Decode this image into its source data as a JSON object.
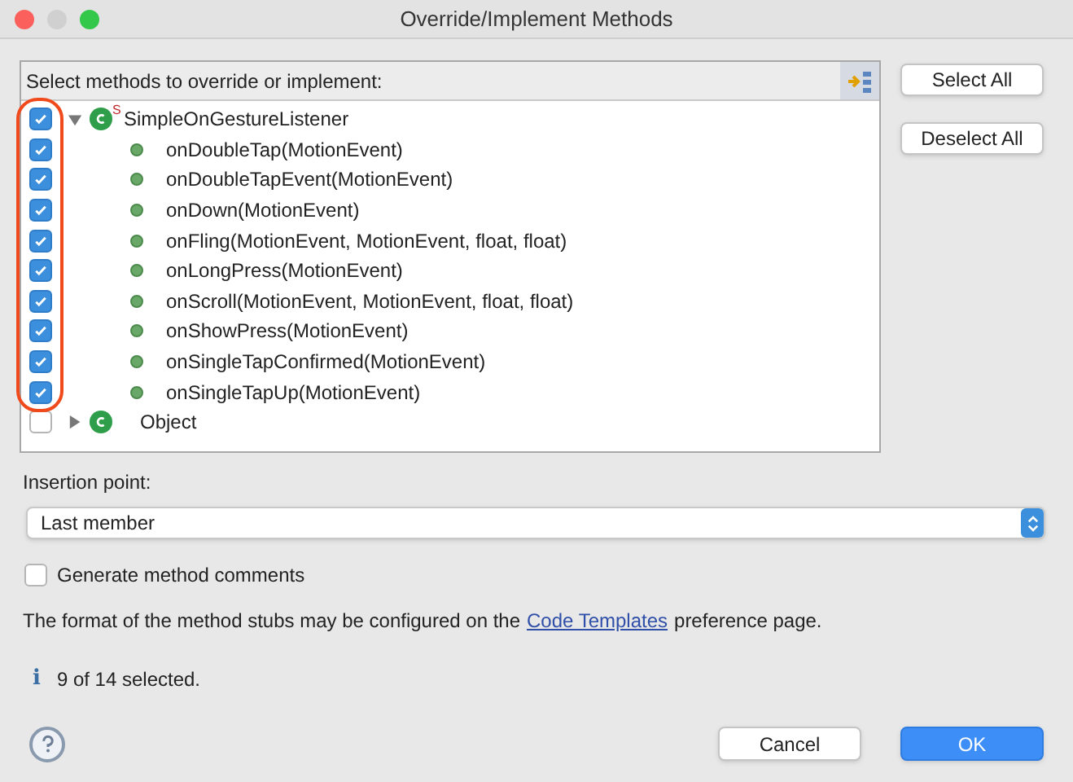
{
  "window": {
    "title": "Override/Implement Methods"
  },
  "methods_panel": {
    "label": "Select methods to override or implement:",
    "tree": [
      {
        "label": "SimpleOnGestureListener",
        "decorator": "S",
        "checked": true,
        "expanded": true,
        "children": [
          {
            "label": "onDoubleTap(MotionEvent)",
            "checked": true
          },
          {
            "label": "onDoubleTapEvent(MotionEvent)",
            "checked": true
          },
          {
            "label": "onDown(MotionEvent)",
            "checked": true
          },
          {
            "label": "onFling(MotionEvent, MotionEvent, float, float)",
            "checked": true
          },
          {
            "label": "onLongPress(MotionEvent)",
            "checked": true
          },
          {
            "label": "onScroll(MotionEvent, MotionEvent, float, float)",
            "checked": true
          },
          {
            "label": "onShowPress(MotionEvent)",
            "checked": true
          },
          {
            "label": "onSingleTapConfirmed(MotionEvent)",
            "checked": true
          },
          {
            "label": "onSingleTapUp(MotionEvent)",
            "checked": true
          }
        ]
      },
      {
        "label": "Object",
        "checked": false,
        "expanded": false
      }
    ]
  },
  "side_buttons": [
    "Select All",
    "Deselect All"
  ],
  "insertion_point": {
    "label": "Insertion point:",
    "value": "Last member"
  },
  "generate_comments": {
    "label": "Generate method comments",
    "checked": false
  },
  "note": {
    "before": "The format of the method stubs may be configured on the",
    "link": "Code Templates",
    "after": "preference page."
  },
  "status": {
    "icon": "i",
    "text": "9 of 14 selected."
  },
  "buttons": [
    {
      "label": "Cancel",
      "default": false
    },
    {
      "label": "OK",
      "default": true
    }
  ]
}
